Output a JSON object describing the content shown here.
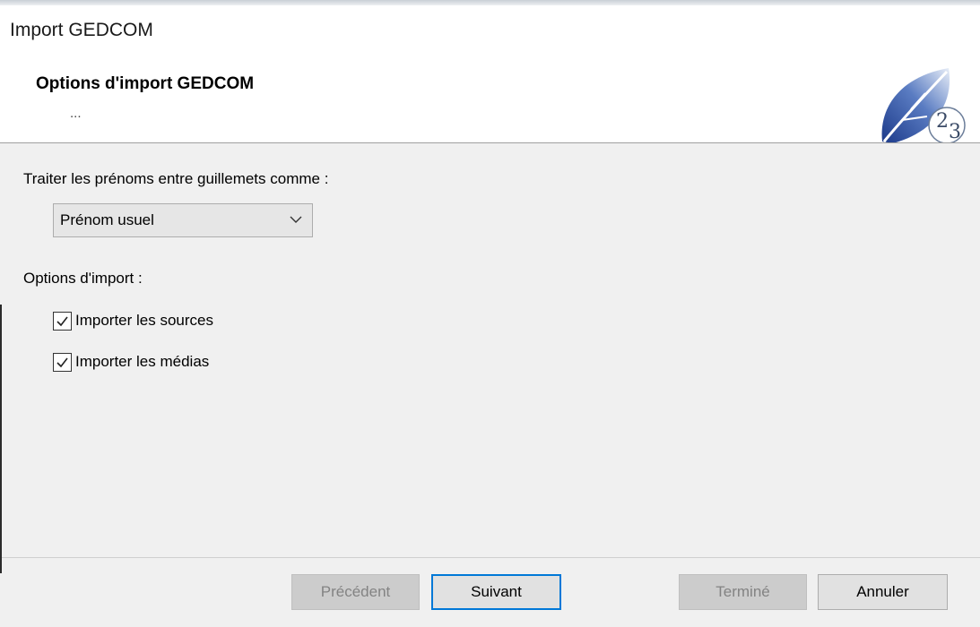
{
  "window": {
    "title": "Import GEDCOM"
  },
  "header": {
    "title": "Options d'import GEDCOM",
    "subtitle": "..."
  },
  "content": {
    "quotes_label": "Traiter les prénoms entre guillemets comme :",
    "quotes_select": {
      "value": "Prénom usuel"
    },
    "options_label": "Options d'import :",
    "checkboxes": [
      {
        "label": "Importer les sources",
        "checked": true
      },
      {
        "label": "Importer les médias",
        "checked": true
      }
    ]
  },
  "footer": {
    "previous": {
      "label": "Précédent",
      "enabled": false
    },
    "next": {
      "label": "Suivant",
      "enabled": true
    },
    "finish": {
      "label": "Terminé",
      "enabled": false
    },
    "cancel": {
      "label": "Annuler",
      "enabled": true
    }
  },
  "colors": {
    "accent": "#0078d7",
    "logo_blue": "#1f3f8f",
    "panel": "#f0f0f0"
  },
  "icons": {
    "logo": "leaf-logo-icon",
    "dropdown": "chevron-down-icon",
    "checkbox": "checkmark-icon"
  }
}
